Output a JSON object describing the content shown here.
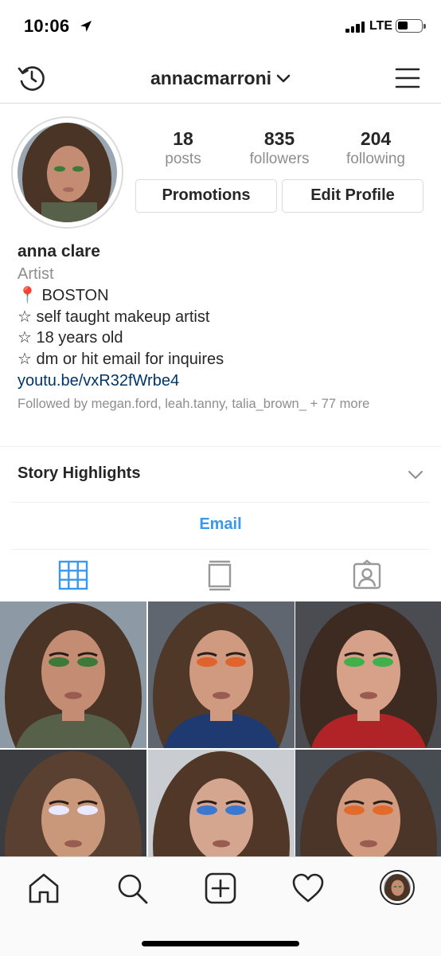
{
  "status_bar": {
    "time": "10:06",
    "network": "LTE",
    "icons": [
      "location-arrow-icon",
      "signal-icon",
      "battery-icon"
    ]
  },
  "header": {
    "username": "annacmarroni",
    "icons": [
      "history-icon",
      "chevron-down-icon",
      "menu-icon"
    ]
  },
  "profile": {
    "stats": [
      {
        "value": "18",
        "label": "posts"
      },
      {
        "value": "835",
        "label": "followers"
      },
      {
        "value": "204",
        "label": "following"
      }
    ],
    "buttons": {
      "promotions": "Promotions",
      "edit_profile": "Edit Profile"
    },
    "name": "anna clare",
    "category": "Artist",
    "bio_lines": [
      "📍 BOSTON",
      "☆ self taught makeup artist",
      "☆ 18 years old",
      "☆ dm or hit email for inquires"
    ],
    "link": "youtu.be/vxR32fWrbe4",
    "followed_by": "Followed by megan.ford, leah.tanny, talia_brown_ + 77 more"
  },
  "story_highlights": {
    "label": "Story Highlights",
    "icon": "chevron-down-icon"
  },
  "email_button": "Email",
  "tabs": [
    "grid-icon",
    "feed-icon",
    "tagged-icon"
  ],
  "grid": {
    "posts": [
      {
        "skin": "#c48d73",
        "hair": "#4a3426",
        "bg": "#8d9aa5",
        "cloth": "#57614a",
        "eye": "#3d7a3a"
      },
      {
        "skin": "#d09a80",
        "hair": "#4f3828",
        "bg": "#5f6670",
        "cloth": "#1f3a70",
        "eye": "#e0622c"
      },
      {
        "skin": "#d6a188",
        "hair": "#3d2a20",
        "bg": "#4b4b52",
        "cloth": "#b02428",
        "eye": "#3fb04a"
      },
      {
        "skin": "#c9987a",
        "hair": "#5a4031",
        "bg": "#3a3c40",
        "cloth": "#dadada",
        "eye": "#e8e8ff"
      },
      {
        "skin": "#d4a58f",
        "hair": "#503728",
        "bg": "#c9ccd0",
        "cloth": "#bcbcbc",
        "eye": "#3c78d0"
      },
      {
        "skin": "#d29b80",
        "hair": "#4b3428",
        "bg": "#474b52",
        "cloth": "#3a3030",
        "eye": "#e26a2a"
      }
    ]
  },
  "bottom_nav": [
    "home-icon",
    "search-icon",
    "new-post-icon",
    "activity-icon",
    "profile-avatar"
  ],
  "colors": {
    "link": "#003569",
    "accent": "#3897f0",
    "muted": "#8e8e8e",
    "text": "#262626",
    "border": "#dbdbdb"
  }
}
